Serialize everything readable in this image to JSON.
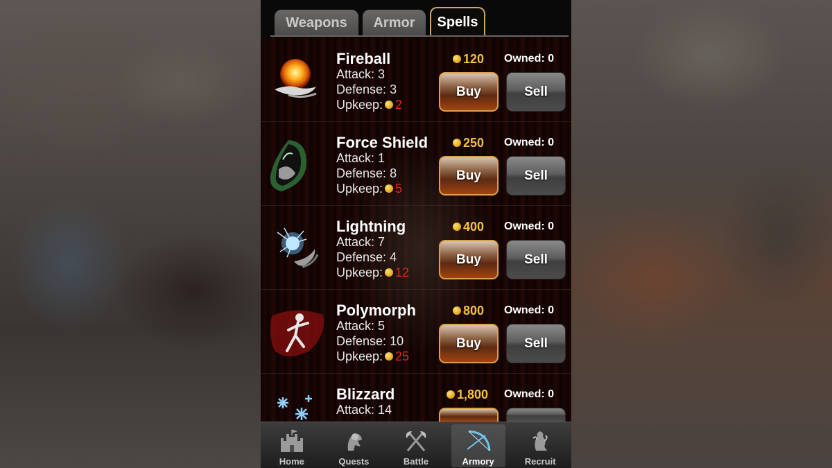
{
  "tabs": [
    {
      "label": "Weapons"
    },
    {
      "label": "Armor"
    },
    {
      "label": "Spells"
    }
  ],
  "active_tab": "Spells",
  "labels": {
    "attack": "Attack:",
    "defense": "Defense:",
    "upkeep": "Upkeep:",
    "owned": "Owned:",
    "buy": "Buy",
    "sell": "Sell"
  },
  "spells": [
    {
      "name": "Fireball",
      "attack": "3",
      "defense": "3",
      "upkeep": "2",
      "price": "120",
      "owned": "0",
      "icon": "fireball-icon"
    },
    {
      "name": "Force Shield",
      "attack": "1",
      "defense": "8",
      "upkeep": "5",
      "price": "250",
      "owned": "0",
      "icon": "force-shield-icon"
    },
    {
      "name": "Lightning",
      "attack": "7",
      "defense": "4",
      "upkeep": "12",
      "price": "400",
      "owned": "0",
      "icon": "lightning-icon"
    },
    {
      "name": "Polymorph",
      "attack": "5",
      "defense": "10",
      "upkeep": "25",
      "price": "800",
      "owned": "0",
      "icon": "polymorph-icon"
    },
    {
      "name": "Blizzard",
      "attack": "14",
      "price": "1,800",
      "owned": "0",
      "icon": "blizzard-icon"
    }
  ],
  "nav": [
    {
      "label": "Home",
      "icon": "castle-icon"
    },
    {
      "label": "Quests",
      "icon": "knight-icon"
    },
    {
      "label": "Battle",
      "icon": "crossed-axes-icon"
    },
    {
      "label": "Armory",
      "icon": "bow-icon"
    },
    {
      "label": "Recruit",
      "icon": "lion-crest-icon"
    }
  ],
  "active_nav": "Armory",
  "colors": {
    "price_gold": "#f3c142",
    "upkeep_red": "#e0261c",
    "buy_border": "#d9a24a",
    "active_tab_border": "#cfa869"
  }
}
